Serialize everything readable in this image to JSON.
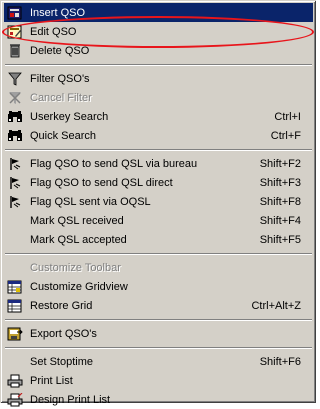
{
  "menu": {
    "items": [
      {
        "label": "Insert QSO",
        "shortcut": "",
        "icon": "insert-icon",
        "state": "highlighted"
      },
      {
        "label": "Edit QSO",
        "shortcut": "",
        "icon": "edit-icon",
        "state": "normal"
      },
      {
        "label": "Delete QSO",
        "shortcut": "",
        "icon": "trash-icon",
        "state": "normal"
      },
      {
        "label": "Filter QSO's",
        "shortcut": "",
        "icon": "filter-icon",
        "state": "normal"
      },
      {
        "label": "Cancel Filter",
        "shortcut": "",
        "icon": "cancel-filter-icon",
        "state": "disabled"
      },
      {
        "label": "Userkey Search",
        "shortcut": "Ctrl+I",
        "icon": "binoculars-icon",
        "state": "normal"
      },
      {
        "label": "Quick Search",
        "shortcut": "Ctrl+F",
        "icon": "binoculars-icon",
        "state": "normal"
      },
      {
        "label": "Flag QSO to send QSL via bureau",
        "shortcut": "Shift+F2",
        "icon": "flag-icon",
        "state": "normal"
      },
      {
        "label": "Flag QSO to send QSL direct",
        "shortcut": "Shift+F3",
        "icon": "flag-icon",
        "state": "normal"
      },
      {
        "label": "Flag QSL sent via OQSL",
        "shortcut": "Shift+F8",
        "icon": "flag-icon",
        "state": "normal"
      },
      {
        "label": "Mark QSL received",
        "shortcut": "Shift+F4",
        "icon": "",
        "state": "normal"
      },
      {
        "label": "Mark QSL accepted",
        "shortcut": "Shift+F5",
        "icon": "",
        "state": "normal"
      },
      {
        "label": "Customize Toolbar",
        "shortcut": "",
        "icon": "",
        "state": "disabled"
      },
      {
        "label": "Customize Gridview",
        "shortcut": "",
        "icon": "grid-icon",
        "state": "normal"
      },
      {
        "label": "Restore Grid",
        "shortcut": "Ctrl+Alt+Z",
        "icon": "restore-grid-icon",
        "state": "normal"
      },
      {
        "label": "Export QSO's",
        "shortcut": "",
        "icon": "export-icon",
        "state": "normal"
      },
      {
        "label": "Set Stoptime",
        "shortcut": "Shift+F6",
        "icon": "",
        "state": "normal"
      },
      {
        "label": "Print List",
        "shortcut": "",
        "icon": "print-icon",
        "state": "normal"
      },
      {
        "label": "Design Print List",
        "shortcut": "",
        "icon": "design-print-icon",
        "state": "normal"
      }
    ]
  },
  "colors": {
    "menu_bg": "#d4d0c8",
    "highlight": "#0a246a",
    "annotation_oval": "#e8151b",
    "disabled_text": "#808080"
  }
}
